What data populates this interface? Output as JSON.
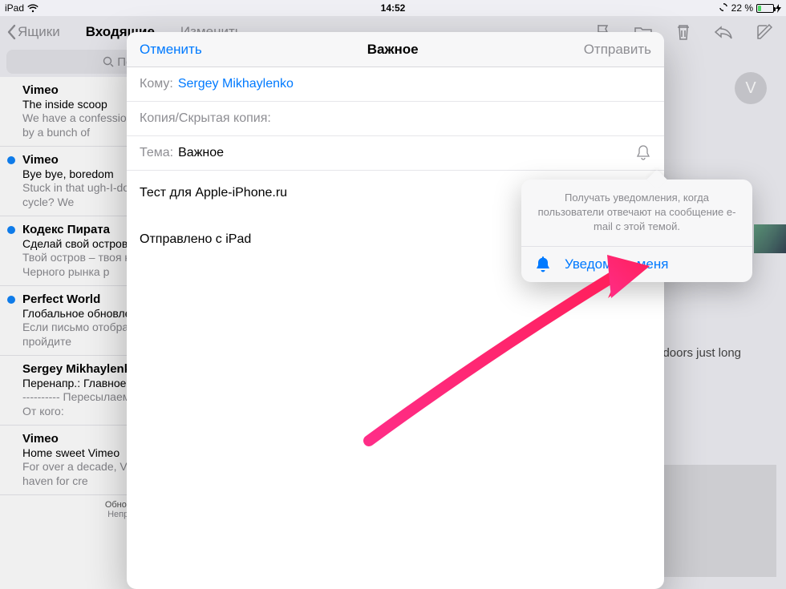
{
  "statusbar": {
    "device": "iPad",
    "time": "14:52",
    "battery_pct": "22 %"
  },
  "toolbar": {
    "back_label": "Ящики",
    "inbox_label": "Входящие",
    "edit_label": "Изменить"
  },
  "search": {
    "placeholder": "Поиск"
  },
  "sidebar": {
    "items": [
      {
        "unread": false,
        "sender": "Vimeo",
        "subject": "The inside scoop",
        "preview": "We have a confession to make: we're built by a bunch of"
      },
      {
        "unread": true,
        "sender": "Vimeo",
        "subject": "Bye bye, boredom",
        "preview": "Stuck in that ugh-I-don't-know-what-to-watch cycle? We"
      },
      {
        "unread": true,
        "sender": "Кодекс Пирата",
        "subject": "Сделай свой остров лучше",
        "preview": "Твой остров – твоя крепость! Товары с Черного рынка р"
      },
      {
        "unread": true,
        "sender": "Perfect World",
        "subject": "Глобальное обновление",
        "preview": "Если письмо отображается некорректно, пройдите"
      },
      {
        "unread": false,
        "sender": "Sergey Mikhaylenko",
        "subject": "Перенапр.: Главное",
        "preview": "---------- Пересылаемое сообщение ---------- От кого:"
      },
      {
        "unread": false,
        "sender": "Vimeo",
        "subject": "Home sweet Vimeo",
        "preview": "For over a decade, Vimeo has been a safe haven for cre"
      }
    ],
    "updated": "Обновлено",
    "unread_label": "Непрочит."
  },
  "compose": {
    "cancel": "Отменить",
    "title": "Важное",
    "send": "Отправить",
    "to_label": "Кому:",
    "to_name": "Sergey Mikhaylenko",
    "cc_label": "Копия/Скрытая копия:",
    "subject_label": "Тема:",
    "subject_value": "Важное",
    "body_line1": "Тест для Apple-iPhone.ru",
    "body_signature": "Отправлено с iPad"
  },
  "popover": {
    "desc": "Получать уведомления, когда пользователи отвечают на сообщение e-mail с этой темой.",
    "action": "Уведомить меня"
  },
  "avatar_initial": "V",
  "msg_body_excerpt": "we love to soak up the sun. It's also why we bring you even more. Step indoors just long"
}
